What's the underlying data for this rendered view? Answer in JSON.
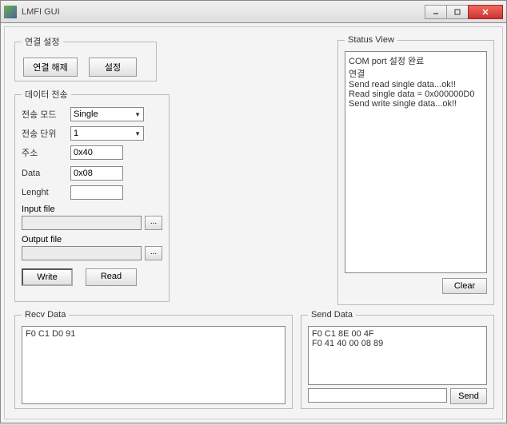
{
  "window": {
    "title": "LMFI GUI"
  },
  "conn": {
    "legend": "연결 설정",
    "disconnect": "연결 해제",
    "settings": "설정"
  },
  "dataTx": {
    "legend": "데이터 전송",
    "modeLabel": "전송 모드",
    "modeValue": "Single",
    "unitLabel": "전송 단위",
    "unitValue": "1",
    "addrLabel": "주소",
    "addrValue": "0x40",
    "dataLabel": "Data",
    "dataValue": "0x08",
    "lengthLabel": "Lenght",
    "lengthValue": "",
    "inputFileLabel": "Input file",
    "inputFileValue": "",
    "outputFileLabel": "Output file",
    "outputFileValue": "",
    "browse": "...",
    "write": "Write",
    "read": "Read"
  },
  "status": {
    "legend": "Status View",
    "text": "COM port 설정 완료\n연결\nSend read single data...ok!!\nRead single data = 0x000000D0\nSend write single data...ok!!",
    "clear": "Clear"
  },
  "recv": {
    "legend": "Recv Data",
    "text": "F0 C1 D0 91"
  },
  "send": {
    "legend": "Send Data",
    "text": "F0 C1 8E 00 4F\nF0 41 40 00 08 89",
    "input": "",
    "button": "Send"
  }
}
